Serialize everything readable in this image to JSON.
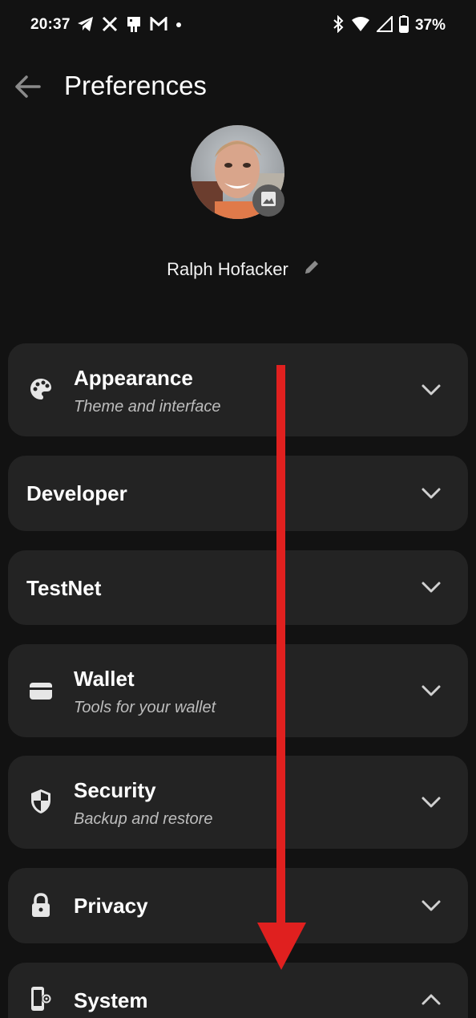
{
  "status_bar": {
    "time": "20:37",
    "left_icons": [
      "telegram-icon",
      "x-icon",
      "app-icon",
      "gmail-icon",
      "dot-icon"
    ],
    "right_icons": [
      "bluetooth-icon",
      "wifi-icon",
      "signal-icon",
      "battery-icon"
    ],
    "battery": "37%"
  },
  "header": {
    "title": "Preferences",
    "back_icon": "arrow-left-icon"
  },
  "profile": {
    "name": "Ralph Hofacker",
    "edit_icon": "pencil-icon",
    "avatar_edit_icon": "image-icon"
  },
  "sections": [
    {
      "title": "Appearance",
      "subtitle": "Theme and interface",
      "icon": "palette-icon",
      "expanded": false
    },
    {
      "title": "Developer",
      "icon": "",
      "expanded": false
    },
    {
      "title": "TestNet",
      "icon": "",
      "expanded": false
    },
    {
      "title": "Wallet",
      "subtitle": "Tools for your wallet",
      "icon": "wallet-icon",
      "expanded": false
    },
    {
      "title": "Security",
      "subtitle": "Backup and restore",
      "icon": "shield-icon",
      "expanded": false
    },
    {
      "title": "Privacy",
      "icon": "lock-icon",
      "expanded": false
    },
    {
      "title": "System",
      "icon": "phone-settings-icon",
      "expanded": true
    }
  ],
  "colors": {
    "background": "#121212",
    "card": "#232323",
    "annotation_arrow": "#e0201f"
  }
}
